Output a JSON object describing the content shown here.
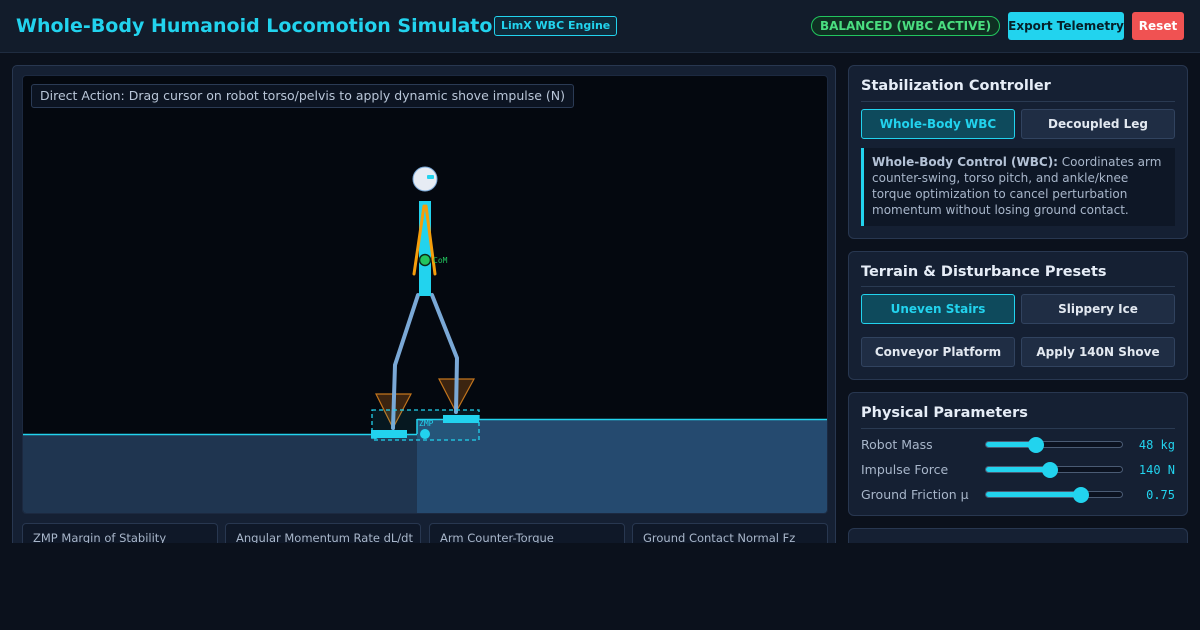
{
  "header": {
    "title": "Whole-Body Humanoid Locomotion Simulator",
    "engine_badge": "LimX WBC Engine",
    "status": "BALANCED (WBC ACTIVE)",
    "export_label": "Export Telemetry",
    "reset_label": "Reset"
  },
  "simulation": {
    "hint": "Direct Action: Drag cursor on robot torso/pelvis to apply dynamic shove impulse (N)",
    "com_label": "CoM",
    "zmp_label": "ZMP",
    "metrics": [
      {
        "label": "ZMP Margin of Stability"
      },
      {
        "label": "Angular Momentum Rate dL/dt"
      },
      {
        "label": "Arm Counter-Torque"
      },
      {
        "label": "Ground Contact Normal Fz"
      }
    ]
  },
  "controller": {
    "title": "Stabilization Controller",
    "modes": [
      {
        "label": "Whole-Body WBC",
        "active": true
      },
      {
        "label": "Decoupled Leg",
        "active": false
      }
    ],
    "description_heading": "Whole-Body Control (WBC):",
    "description_body": " Coordinates arm counter-swing, torso pitch, and ankle/knee torque optimization to cancel perturbation momentum without losing ground contact."
  },
  "terrain": {
    "title": "Terrain & Disturbance Presets",
    "presets": [
      {
        "label": "Uneven Stairs",
        "active": true
      },
      {
        "label": "Slippery Ice",
        "active": false
      },
      {
        "label": "Conveyor Platform",
        "active": false
      },
      {
        "label": "Apply 140N Shove",
        "active": false
      }
    ]
  },
  "parameters": {
    "title": "Physical Parameters",
    "items": [
      {
        "label": "Robot Mass",
        "value": "48 kg",
        "fraction": 0.37
      },
      {
        "label": "Impulse Force",
        "value": "140 N",
        "fraction": 0.47
      },
      {
        "label": "Ground Friction μ",
        "value": "0.75",
        "fraction": 0.7
      }
    ]
  },
  "colors": {
    "accent": "#22d3ee",
    "status_ok": "#4ade80",
    "danger": "#f05252",
    "robot_arm": "#f59e0b",
    "com_marker": "#22c55e"
  }
}
